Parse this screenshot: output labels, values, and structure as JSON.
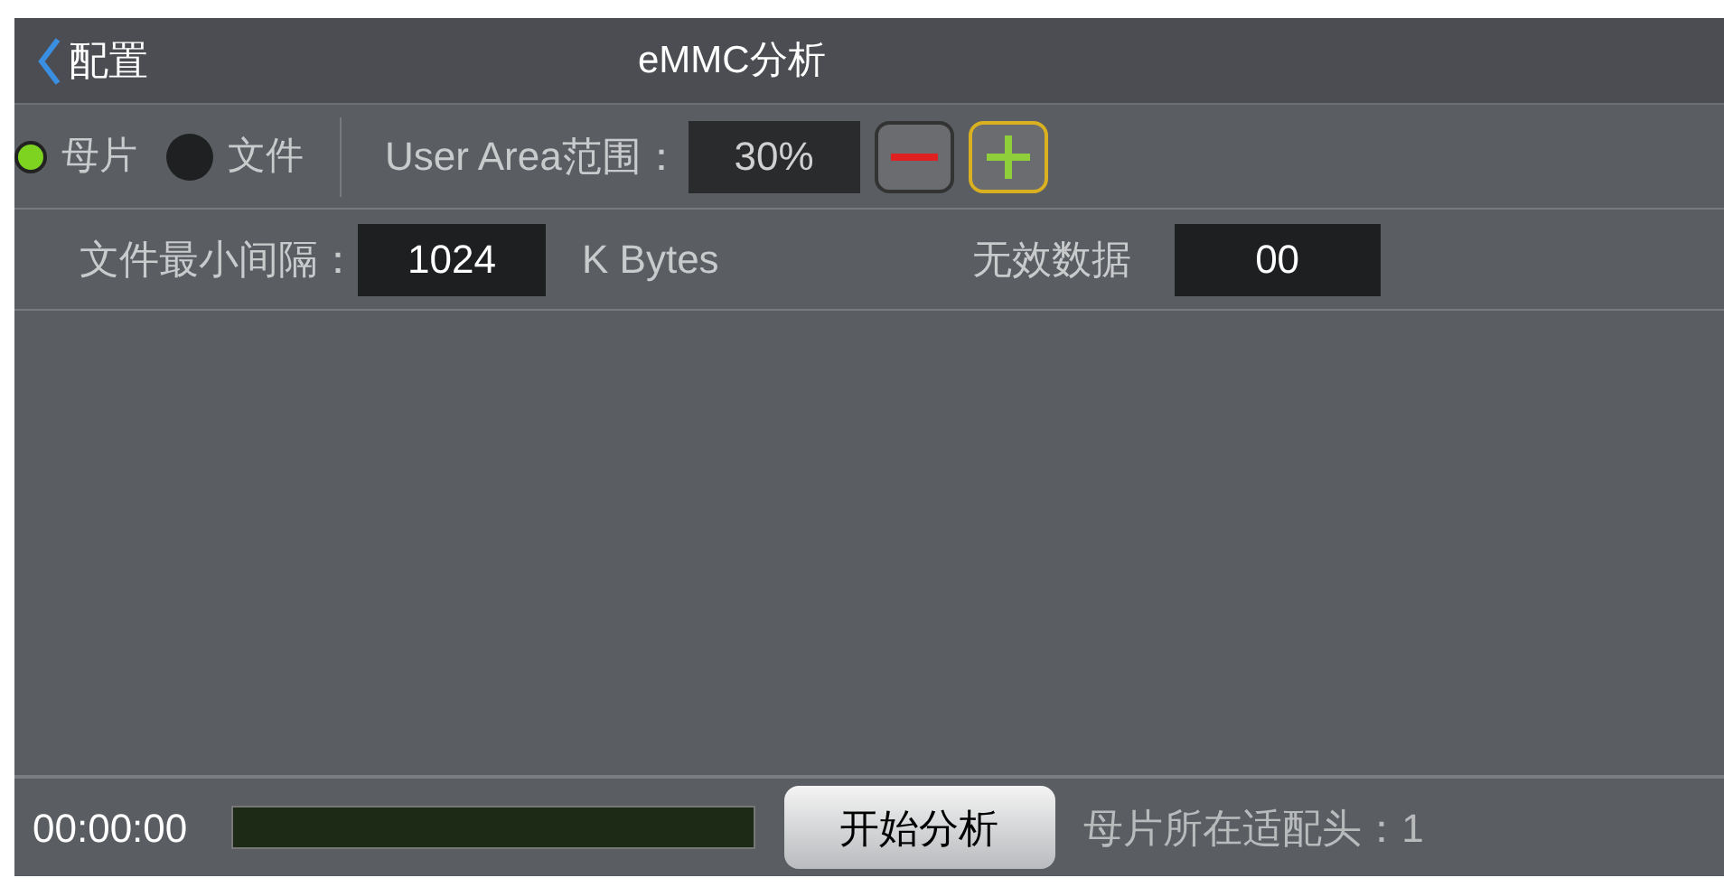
{
  "header": {
    "back_label": "配置",
    "title": "eMMC分析"
  },
  "source_options": [
    {
      "label": "母片",
      "selected": true
    },
    {
      "label": "文件",
      "selected": false
    }
  ],
  "user_area": {
    "label": "User Area范围：",
    "value": "30%"
  },
  "min_interval": {
    "label": "文件最小间隔：",
    "value": "1024",
    "unit": "K Bytes"
  },
  "invalid_data": {
    "label": "无效数据",
    "value": "00"
  },
  "footer": {
    "time": "00:00:00",
    "progress": {
      "level": 0
    },
    "start_button": "开始分析",
    "status": "母片所在适配头：1"
  }
}
